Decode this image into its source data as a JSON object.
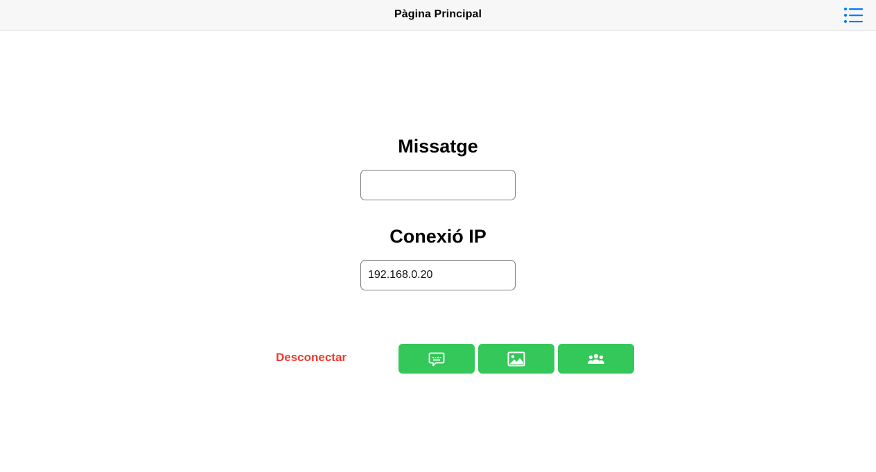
{
  "header": {
    "title": "Pàgina Principal",
    "menu_icon": "list-icon",
    "accent_color": "#007aff"
  },
  "message": {
    "heading": "Missatge",
    "value": ""
  },
  "connection": {
    "heading": "Conexió IP",
    "value": "192.168.0.20"
  },
  "actions": {
    "disconnect_label": "Desconectar",
    "disconnect_color": "#f03a2f",
    "button_color": "#34c759",
    "buttons": [
      {
        "icon": "message-icon"
      },
      {
        "icon": "image-icon"
      },
      {
        "icon": "group-icon"
      }
    ]
  }
}
